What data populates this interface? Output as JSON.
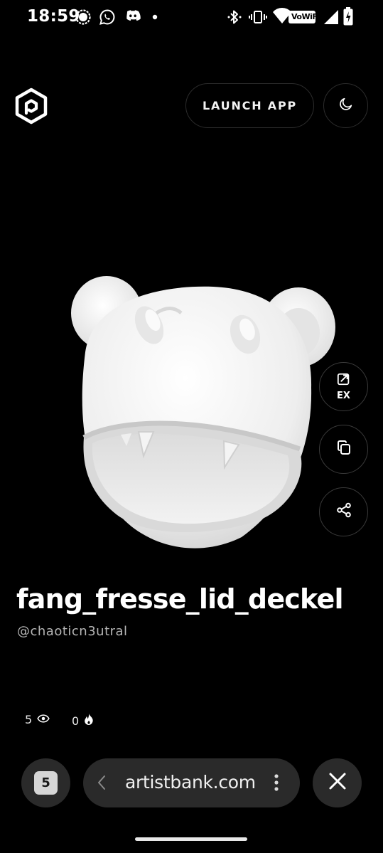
{
  "status_bar": {
    "time": "18:59",
    "wifi_label": "VoWiFi",
    "icons": [
      "signal-messenger-icon",
      "whatsapp-icon",
      "discord-icon",
      "notification-dot-icon",
      "bluetooth-icon",
      "vibrate-icon",
      "wifi-icon",
      "cell-signal-icon",
      "battery-icon"
    ]
  },
  "header": {
    "logo": "artistbank-logo-icon",
    "launch_label": "LAUNCH APP",
    "theme_icon": "moon-icon"
  },
  "side_actions": {
    "export_label": "EX",
    "export_icon": "export-edit-icon",
    "copy_icon": "copy-icon",
    "share_icon": "share-icon"
  },
  "item": {
    "title": "fang_fresse_lid_deckel",
    "author": "@chaoticn3utral"
  },
  "stats": {
    "views": "5",
    "views_icon": "eye-icon",
    "likes": "0",
    "likes_icon": "fire-icon"
  },
  "browser": {
    "tab_count": "5",
    "url": "artistbank.com",
    "back_icon": "chevron-left-icon",
    "menu_icon": "more-vertical-icon",
    "close_icon": "close-icon"
  }
}
